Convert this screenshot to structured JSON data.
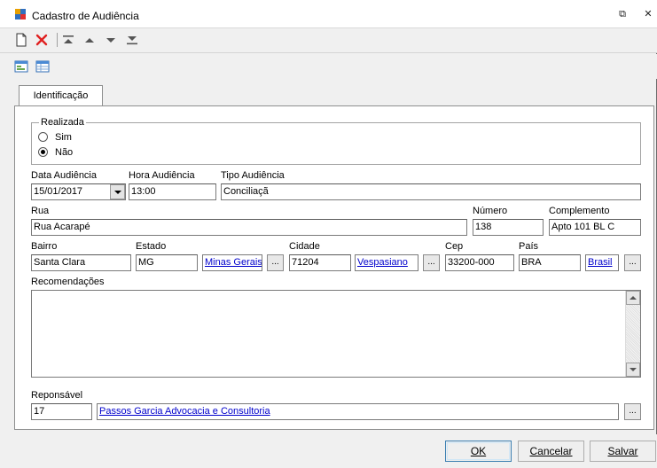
{
  "window": {
    "title": "Cadastro de Audiência",
    "restore_glyph": "⧉",
    "close_glyph": "✕"
  },
  "toolbar": {
    "icons": [
      "new-document-icon",
      "delete-icon",
      "first-record-icon",
      "previous-record-icon",
      "next-record-icon",
      "last-record-icon"
    ],
    "accent_delete": "#e02020"
  },
  "viewbar": {
    "icons": [
      "form-view-icon",
      "grid-view-icon"
    ]
  },
  "tabs": [
    {
      "label": "Identificação"
    }
  ],
  "realizada": {
    "legend": "Realizada",
    "options": [
      {
        "label": "Sim",
        "checked": false
      },
      {
        "label": "Não",
        "checked": true
      }
    ]
  },
  "fields": {
    "data_audiencia": {
      "label": "Data Audiência",
      "value": "15/01/2017"
    },
    "hora_audiencia": {
      "label": "Hora Audiência",
      "value": "13:00"
    },
    "tipo_audiencia": {
      "label": "Tipo Audiência",
      "value": "Conciliaçã"
    },
    "rua": {
      "label": "Rua",
      "value": "Rua Acarapé"
    },
    "numero": {
      "label": "Número",
      "value": "138"
    },
    "complemento": {
      "label": "Complemento",
      "value": "Apto 101 BL C"
    },
    "bairro": {
      "label": "Bairro",
      "value": "Santa Clara"
    },
    "estado": {
      "label": "Estado",
      "value": "MG",
      "link": "Minas Gerais"
    },
    "cidade": {
      "label": "Cidade",
      "value": "71204",
      "link": "Vespasiano"
    },
    "cep": {
      "label": "Cep",
      "value": "33200-000"
    },
    "pais": {
      "label": "País",
      "value": "BRA",
      "link": "Brasil"
    },
    "recomendacoes": {
      "label": "Recomendações",
      "value": ""
    },
    "responsavel": {
      "label": "Reponsável",
      "value": "17",
      "link": "Passos Garcia Advocacia e Consultoria"
    }
  },
  "lookup_button_label": "...",
  "buttons": {
    "ok": "OK",
    "cancelar": "Cancelar",
    "salvar": "Salvar"
  },
  "colors": {
    "link": "#0000cc",
    "window_bg": "#f0f0f0"
  }
}
